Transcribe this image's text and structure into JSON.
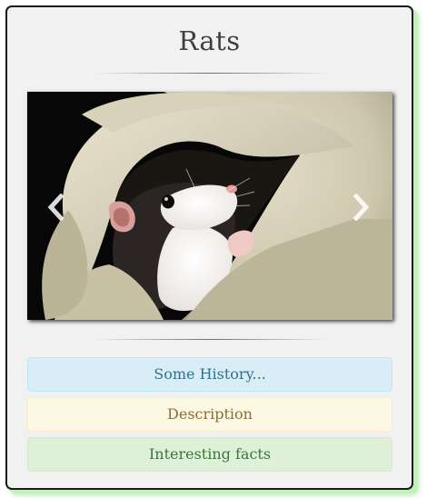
{
  "page": {
    "title": "Rats"
  },
  "carousel": {
    "image_subject": "rat-in-fleece-blanket",
    "prev_icon": "chevron-left-icon",
    "next_icon": "chevron-right-icon"
  },
  "panels": [
    {
      "label": "Some History...",
      "style": "info",
      "color": "#31708f"
    },
    {
      "label": "Description",
      "style": "warning",
      "color": "#8a6d3b"
    },
    {
      "label": "Interesting facts",
      "style": "success",
      "color": "#3c763d"
    }
  ],
  "colors": {
    "card_bg": "#f1f1f1",
    "glow": "#bff0b8",
    "info_bg": "#d9edf7",
    "warning_bg": "#fcf8e3",
    "success_bg": "#dff0d8"
  }
}
